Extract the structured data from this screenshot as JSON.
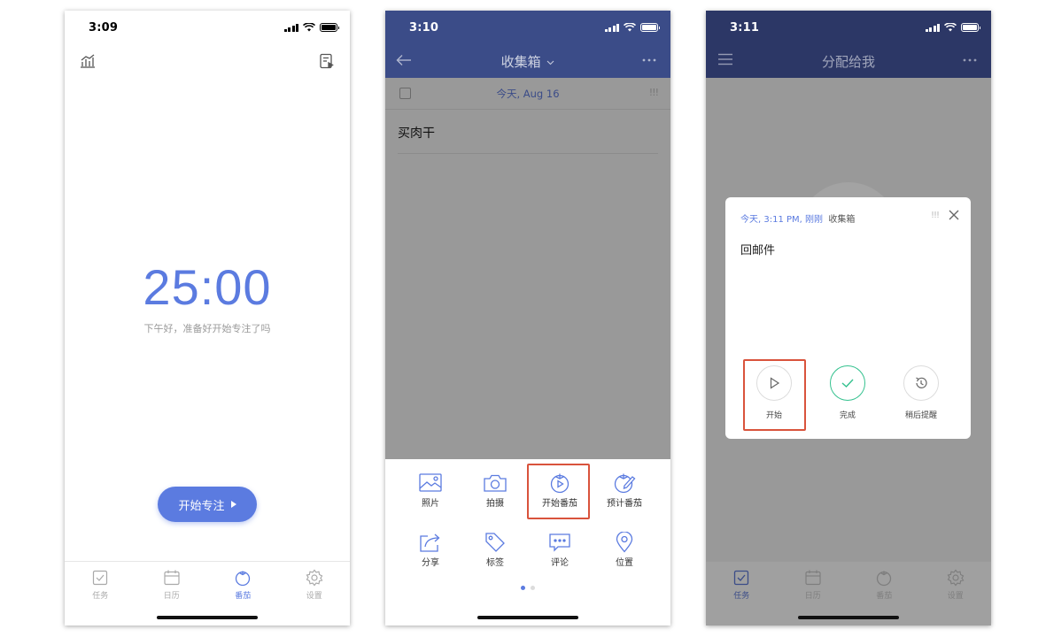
{
  "tab_labels": [
    "任务",
    "日历",
    "番茄",
    "设置"
  ],
  "colors": {
    "accent": "#5b7be0",
    "navbar": "#3b4c88",
    "highlight": "#d9533c",
    "done": "#33c18e"
  },
  "phone1": {
    "status_time": "3:09",
    "timer": "25:00",
    "greeting": "下午好，准备好开始专注了吗",
    "start_button": "开始专注",
    "active_tab": 2
  },
  "phone2": {
    "status_time": "3:10",
    "nav_title": "收集箱",
    "date": "今天, Aug 16",
    "priority": "!!!",
    "task": "买肉干",
    "sheet_items": [
      {
        "label": "照片",
        "icon": "photo-icon"
      },
      {
        "label": "拍摄",
        "icon": "camera-icon"
      },
      {
        "label": "开始番茄",
        "icon": "tomato-play-icon"
      },
      {
        "label": "预计番茄",
        "icon": "tomato-edit-icon"
      },
      {
        "label": "分享",
        "icon": "share-icon"
      },
      {
        "label": "标签",
        "icon": "tag-icon"
      },
      {
        "label": "评论",
        "icon": "comment-icon"
      },
      {
        "label": "位置",
        "icon": "location-icon"
      }
    ],
    "page_dots": {
      "count": 2,
      "active": 0
    }
  },
  "phone3": {
    "status_time": "3:11",
    "nav_title": "分配给我",
    "popup": {
      "meta_time": "今天, 3:11 PM, 刚刚",
      "meta_list": "收集箱",
      "priority": "!!!",
      "task": "回邮件",
      "actions": [
        {
          "label": "开始",
          "icon": "play-icon"
        },
        {
          "label": "完成",
          "icon": "check-icon"
        },
        {
          "label": "稍后提醒",
          "icon": "snooze-icon"
        }
      ]
    },
    "active_tab": 0
  }
}
